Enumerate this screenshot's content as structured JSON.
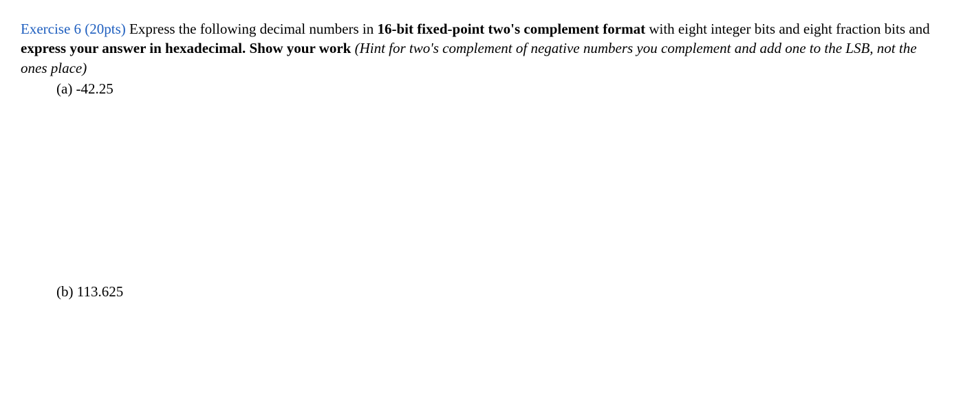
{
  "exercise": {
    "label": "Exercise 6 (20pts)",
    "intro_text_1": " Express the following decimal numbers in ",
    "bold_format": "16-bit fixed-point two's complement format",
    "intro_text_2": " with eight integer bits and eight fraction bits and ",
    "bold_instruction": "express your answer in hexadecimal. Show your work",
    "space": " ",
    "hint_italic": "(Hint for two's complement of negative numbers you complement and add one to the LSB, not the ones place)"
  },
  "items": {
    "a_label": "(a) -42.25",
    "b_label": "(b) 113.625"
  }
}
